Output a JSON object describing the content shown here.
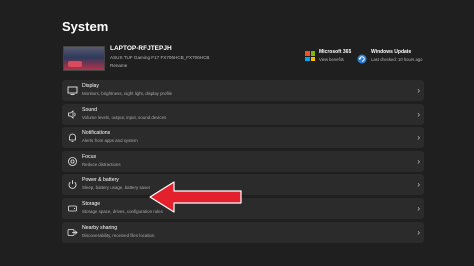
{
  "page": {
    "title": "System"
  },
  "device": {
    "name": "LAPTOP-RFJTEPJH",
    "model": "ASUS TUF Gaming F17 FX706HCB_FX706HCB",
    "rename": "Rename"
  },
  "microsoft365": {
    "title": "Microsoft 365",
    "subtitle": "View benefits"
  },
  "windows_update": {
    "title": "Windows Update",
    "subtitle": "Last checked: 10 hours ago"
  },
  "settings": [
    {
      "icon": "display-icon",
      "label": "Display",
      "description": "Monitors, brightness, night light, display profile"
    },
    {
      "icon": "sound-icon",
      "label": "Sound",
      "description": "Volume levels, output, input, sound devices"
    },
    {
      "icon": "notifications-icon",
      "label": "Notifications",
      "description": "Alerts from apps and system"
    },
    {
      "icon": "focus-icon",
      "label": "Focus",
      "description": "Reduce distractions"
    },
    {
      "icon": "power-icon",
      "label": "Power & battery",
      "description": "Sleep, battery usage, battery saver"
    },
    {
      "icon": "storage-icon",
      "label": "Storage",
      "description": "Storage space, drives, configuration rules"
    },
    {
      "icon": "nearby-sharing-icon",
      "label": "Nearby sharing",
      "description": "Discoverability, received files location"
    }
  ],
  "chevron": "›",
  "colors": {
    "background": "#1f1f1f",
    "row": "#2b2b2b",
    "arrow": "#e3202b",
    "ms_red": "#f25022",
    "ms_green": "#7fba00",
    "ms_blue": "#00a4ef",
    "ms_yellow": "#ffb900"
  }
}
